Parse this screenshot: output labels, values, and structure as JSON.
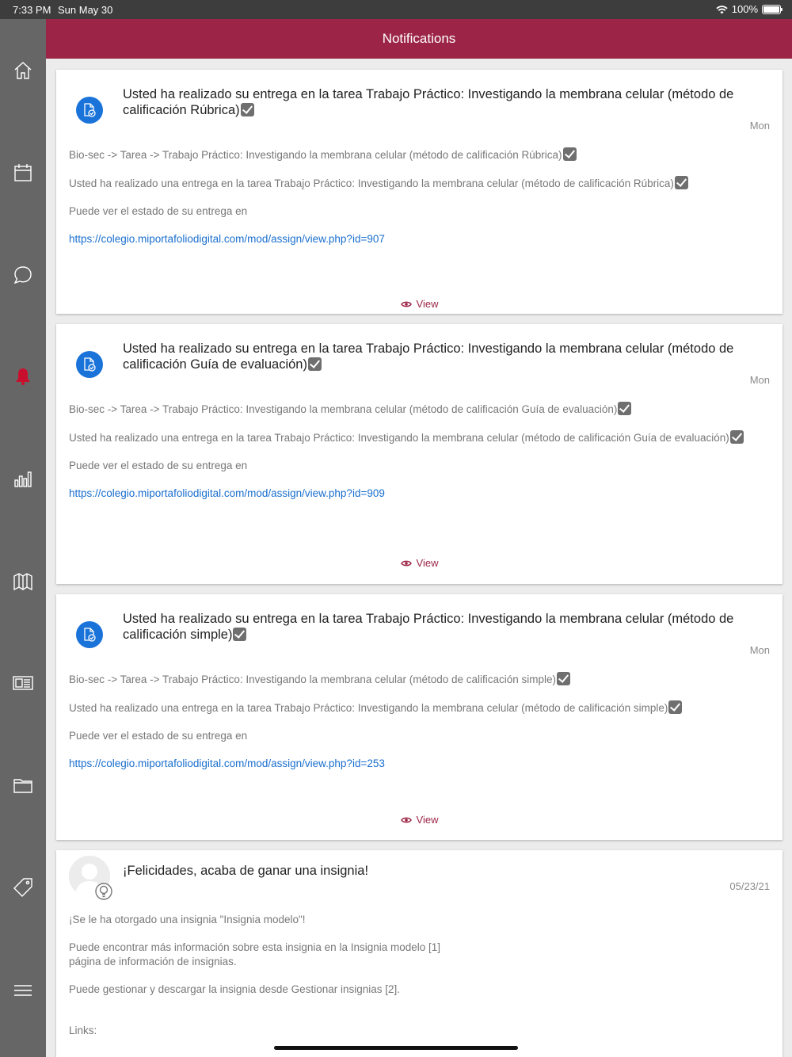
{
  "status": {
    "time": "7:33 PM",
    "date": "Sun May 30",
    "battery": "100%"
  },
  "header": {
    "title": "Notifications"
  },
  "sidebar": {
    "items": [
      {
        "icon": "home-icon"
      },
      {
        "icon": "calendar-icon"
      },
      {
        "icon": "chat-icon"
      },
      {
        "icon": "bell-icon"
      },
      {
        "icon": "bar-chart-icon"
      },
      {
        "icon": "map-icon"
      },
      {
        "icon": "newspaper-icon"
      },
      {
        "icon": "folder-icon"
      },
      {
        "icon": "tag-icon"
      },
      {
        "icon": "menu-icon"
      }
    ],
    "active_color": "#c8102e"
  },
  "notifications": [
    {
      "title": "Usted ha realizado su entrega en la tarea Trabajo Práctico: Investigando la membrana celular (método de calificación Rúbrica)",
      "date": "Mon",
      "line1": "Bio-sec -> Tarea -> Trabajo Práctico: Investigando la membrana celular (método de calificación Rúbrica)",
      "line2": "Usted ha realizado una entrega en la tarea Trabajo Práctico: Investigando la membrana celular (método de calificación Rúbrica)",
      "line3": "Puede ver el estado de su entrega en",
      "link": "https://colegio.miportafoliodigital.com/mod/assign/view.php?id=907",
      "view": "View"
    },
    {
      "title": "Usted ha realizado su entrega en la tarea Trabajo Práctico: Investigando la membrana celular (método de calificación Guía de evaluación)",
      "date": "Mon",
      "line1": "Bio-sec -> Tarea -> Trabajo Práctico: Investigando la membrana celular (método de calificación Guía de evaluación)",
      "line2": "Usted ha realizado una entrega en la tarea Trabajo Práctico: Investigando la membrana celular (método de calificación Guía de evaluación)",
      "line3": "Puede ver el estado de su entrega en",
      "link": "https://colegio.miportafoliodigital.com/mod/assign/view.php?id=909",
      "view": "View"
    },
    {
      "title": "Usted ha realizado su entrega en la tarea Trabajo Práctico: Investigando la membrana celular (método de calificación simple)",
      "date": "Mon",
      "line1": "Bio-sec -> Tarea -> Trabajo Práctico: Investigando la membrana celular (método de calificación simple)",
      "line2": "Usted ha realizado una entrega en la tarea Trabajo Práctico: Investigando la membrana celular (método de calificación simple)",
      "line3": "Puede ver el estado de su entrega en",
      "link": "https://colegio.miportafoliodigital.com/mod/assign/view.php?id=253",
      "view": "View"
    }
  ],
  "badge_notification": {
    "title": "¡Felicidades, acaba de ganar una insignia!",
    "date": "05/23/21",
    "line1": "¡Se le ha otorgado una insignia \"Insignia modelo\"!",
    "line2": "Puede encontrar más información sobre esta insignia en la Insignia modelo [1] página de información de insignias.",
    "line3": "Puede gestionar y descargar la insignia desde Gestionar insignias [2].",
    "line4": "Links:"
  }
}
